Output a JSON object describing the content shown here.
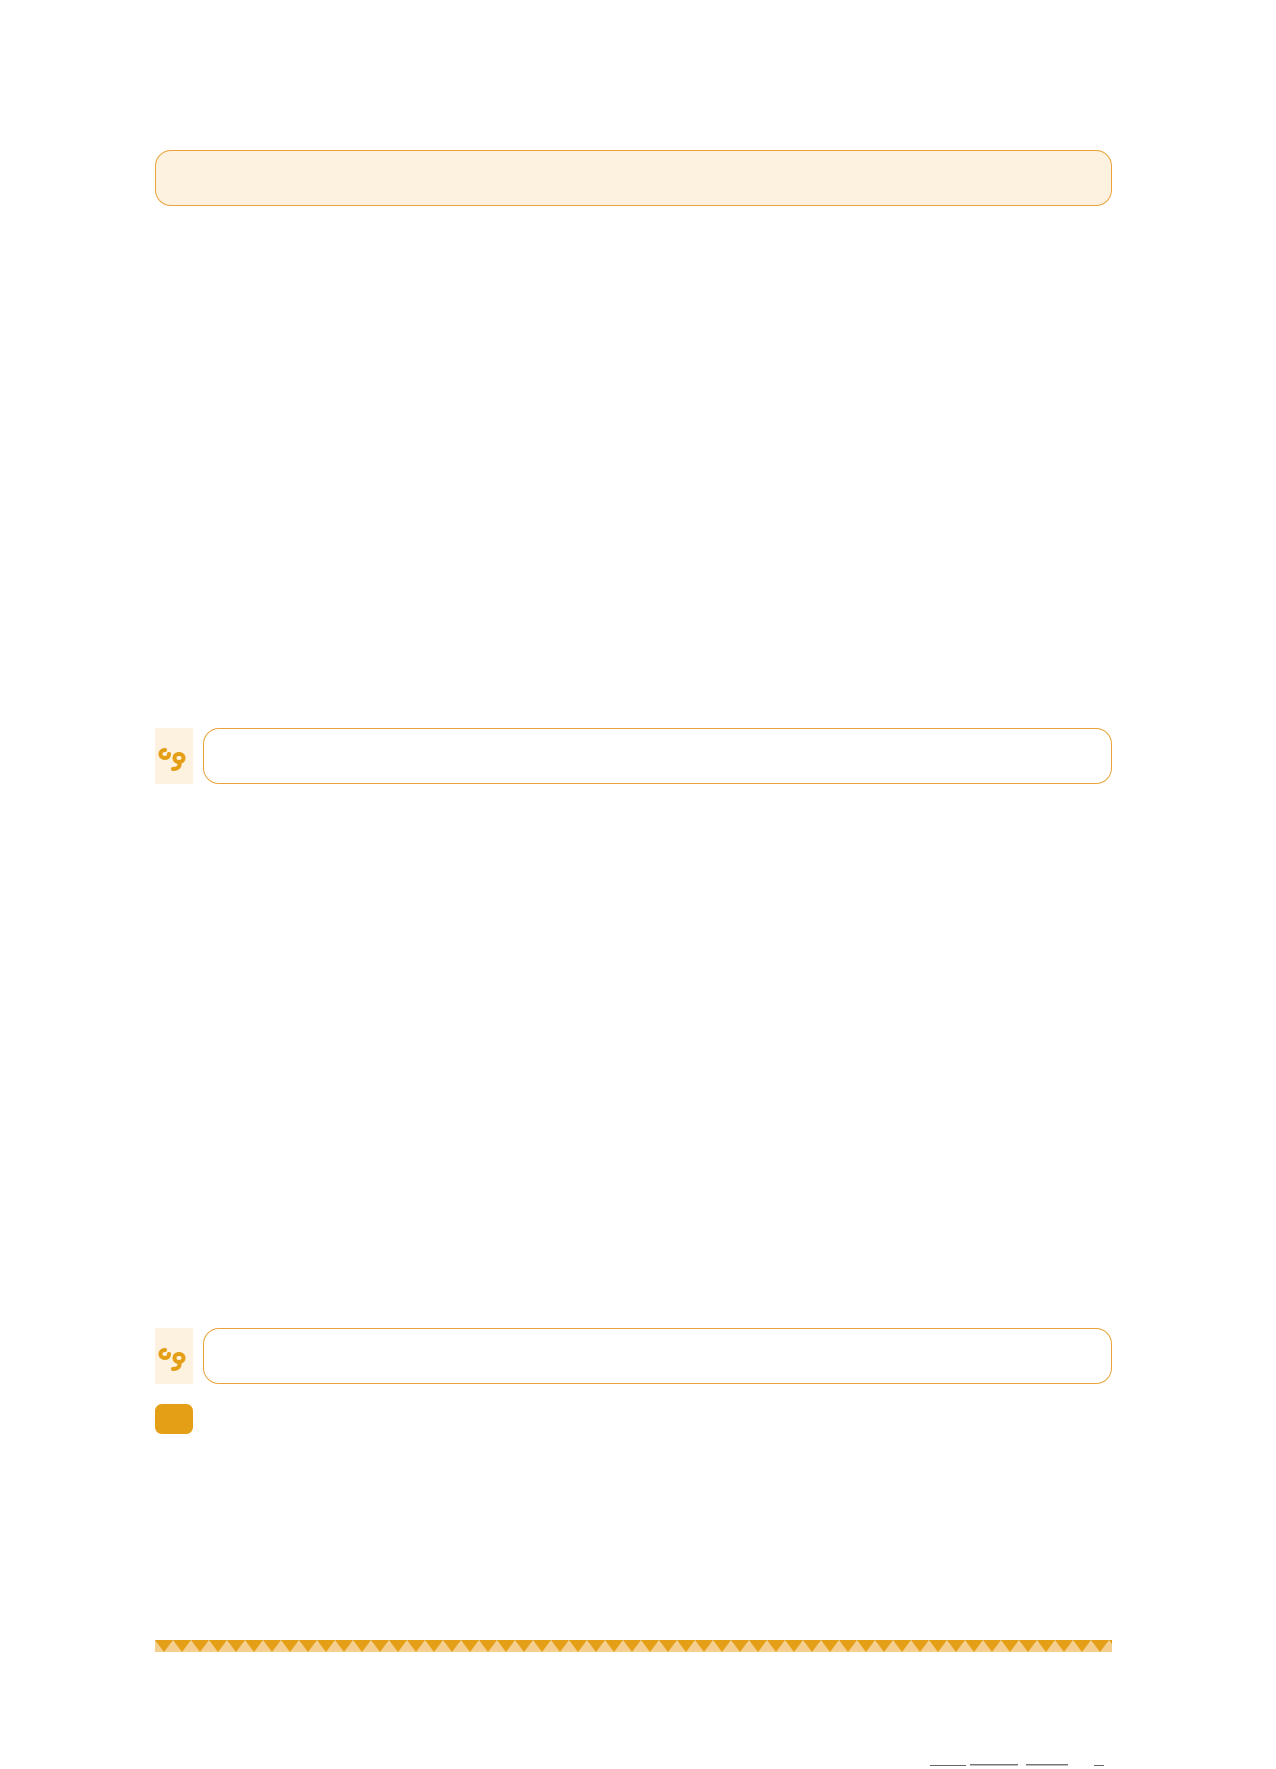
{
  "colors": {
    "accent": "#e8a33a",
    "panel_fill": "#fdf1df",
    "badge": "#e59f16"
  },
  "icons": {
    "quote_icon": "quote-icon"
  }
}
